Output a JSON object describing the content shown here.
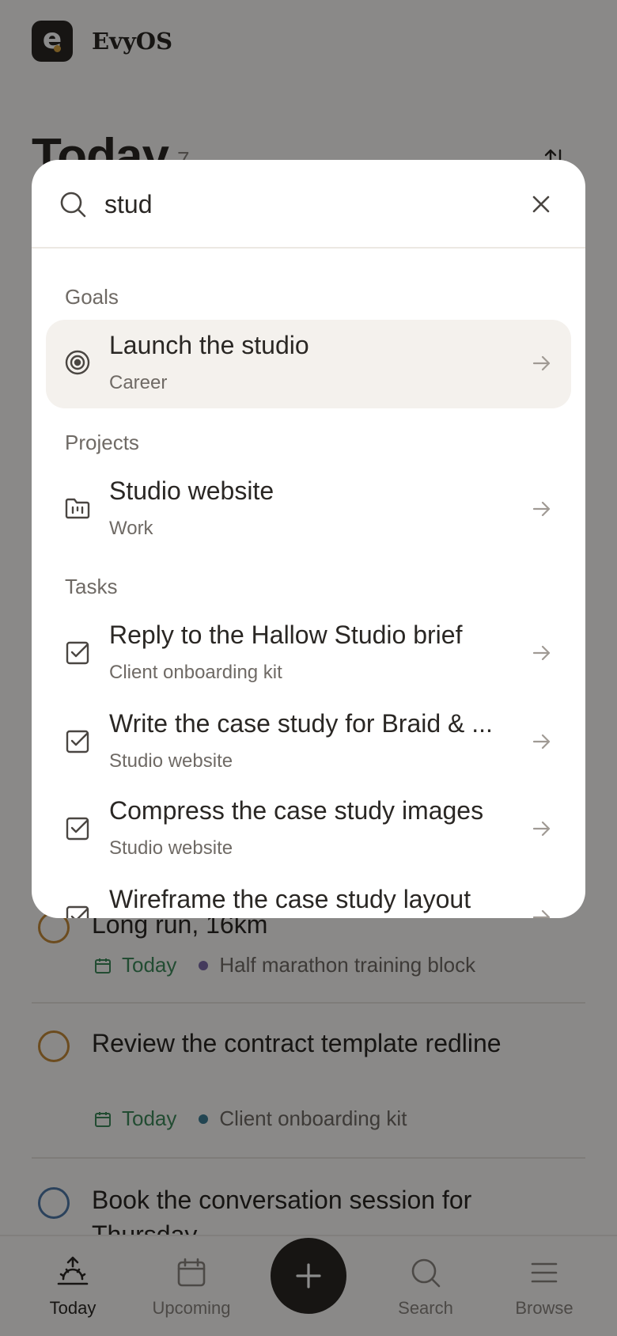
{
  "app": {
    "name": "EvyOS",
    "logo_letter": "e"
  },
  "page": {
    "title": "Today",
    "count": "7"
  },
  "tasks": [
    {
      "title": "Long run, 16km",
      "date": "Today",
      "project": "Half marathon training block",
      "circle_color": "#c58a3a",
      "dot_color": "#7c6ba8"
    },
    {
      "title": "Review the contract template redline",
      "date": "Today",
      "project": "Client onboarding kit",
      "circle_color": "#c58a3a",
      "dot_color": "#3f7f96"
    },
    {
      "title": "Book the conversation session for Thursday",
      "date": "",
      "project": "",
      "circle_color": "#4f78a8",
      "dot_color": ""
    }
  ],
  "tabbar": {
    "items": [
      {
        "label": "Today",
        "icon": "sunrise-icon",
        "active": true
      },
      {
        "label": "Upcoming",
        "icon": "calendar-icon",
        "active": false
      },
      {
        "label": "Search",
        "icon": "search-icon",
        "active": false
      },
      {
        "label": "Browse",
        "icon": "menu-icon",
        "active": false
      }
    ],
    "add_icon": "plus-icon"
  },
  "search": {
    "query": "stud",
    "sections": {
      "goals": {
        "label": "Goals",
        "items": [
          {
            "title": "Launch the studio",
            "subtitle": "Career",
            "icon": "target-icon"
          }
        ]
      },
      "projects": {
        "label": "Projects",
        "items": [
          {
            "title": "Studio website",
            "subtitle": "Work",
            "icon": "folder-icon"
          }
        ]
      },
      "tasks": {
        "label": "Tasks",
        "items": [
          {
            "title": "Reply to the Hallow Studio brief",
            "subtitle": "Client onboarding kit",
            "icon": "checkbox-icon"
          },
          {
            "title": "Write the case study for Braid & ...",
            "subtitle": "Studio website",
            "icon": "checkbox-icon"
          },
          {
            "title": "Compress the case study images",
            "subtitle": "Studio website",
            "icon": "checkbox-icon"
          },
          {
            "title": "Wireframe the case study layout",
            "subtitle": "",
            "icon": "checkbox-icon"
          }
        ]
      }
    }
  },
  "colors": {
    "accent_dark": "#2a2724",
    "date_green": "#3f8a5c",
    "highlight": "#f4f1ed"
  }
}
